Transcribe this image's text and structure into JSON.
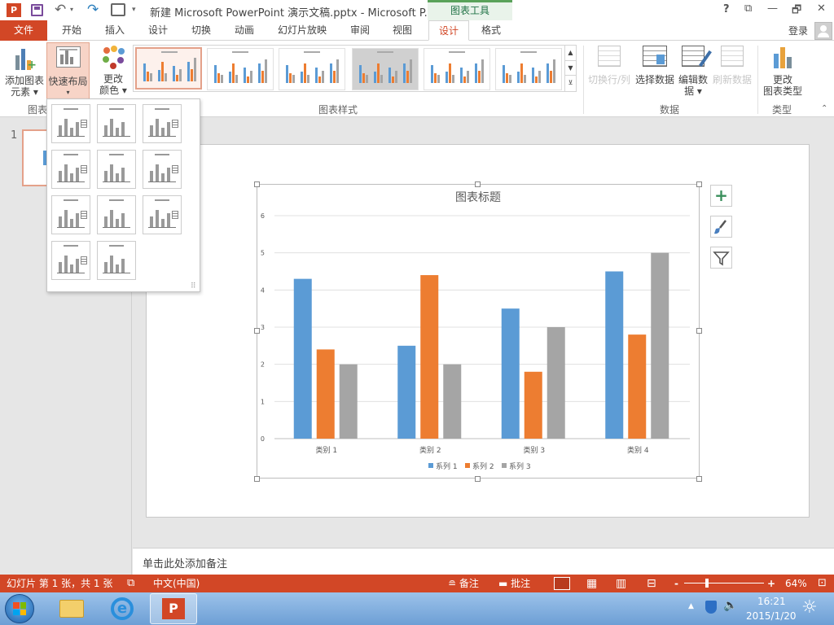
{
  "window": {
    "title": "新建 Microsoft PowerPoint 演示文稿.pptx - Microsoft P...",
    "context_tab": "图表工具",
    "help": "?",
    "restore": "⧉",
    "minimize": "—",
    "maximize": "🗗",
    "close": "✕"
  },
  "menu": {
    "file": "文件",
    "tabs": [
      "开始",
      "插入",
      "设计",
      "切换",
      "动画",
      "幻灯片放映",
      "审阅",
      "视图",
      "设计",
      "格式"
    ],
    "login": "登录"
  },
  "ribbon": {
    "add_element": [
      "添加图表",
      "元素"
    ],
    "quick_layout": "快速布局",
    "change_color": [
      "更改",
      "颜色"
    ],
    "switch_row_col": "切换行/列",
    "select_data": "选择数据",
    "edit_data": [
      "编辑数",
      "据"
    ],
    "refresh_data": "刷新数据",
    "change_type": [
      "更改",
      "图表类型"
    ],
    "groups": {
      "layouts": "图表",
      "styles": "图表样式",
      "data": "数据",
      "type": "类型"
    }
  },
  "slide_panel": {
    "number": "1"
  },
  "notes_placeholder": "单击此处添加备注",
  "status": {
    "slide_info": "幻灯片 第 1 张，共 1 张",
    "language": "中文(中国)",
    "notes": "备注",
    "comments": "批注",
    "zoom": "64%",
    "minus": "-",
    "plus": "+"
  },
  "taskbar": {
    "time": "16:21",
    "date": "2015/1/20"
  },
  "colors": {
    "series1": "#5b9bd5",
    "series2": "#ed7d31",
    "series3": "#a5a5a5",
    "accent": "#d24726"
  },
  "chart_data": {
    "type": "bar",
    "title": "图表标题",
    "categories": [
      "类别 1",
      "类别 2",
      "类别 3",
      "类别 4"
    ],
    "series": [
      {
        "name": "系列 1",
        "values": [
          4.3,
          2.5,
          3.5,
          4.5
        ]
      },
      {
        "name": "系列 2",
        "values": [
          2.4,
          4.4,
          1.8,
          2.8
        ]
      },
      {
        "name": "系列 3",
        "values": [
          2,
          2,
          3,
          5
        ]
      }
    ],
    "ylim": [
      0,
      6
    ],
    "yticks": [
      "0",
      "1",
      "2",
      "3",
      "4",
      "5",
      "6"
    ],
    "grid": true,
    "legend": "bottom"
  }
}
